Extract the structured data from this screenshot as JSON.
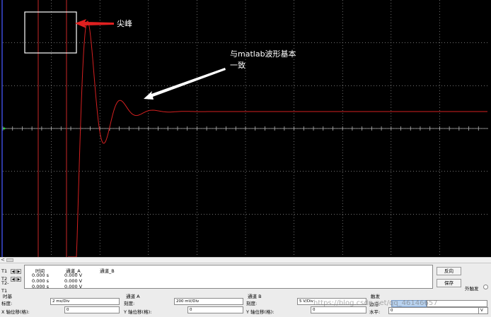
{
  "colors": {
    "screen_bg": "#000000",
    "grid": "#b4b4b4",
    "trace": "#d42020",
    "cursor_line": "#c82828",
    "annotation_red": "#e02020",
    "annotation_white": "#ffffff"
  },
  "annotations": {
    "peak": "尖峰",
    "match_line1": "与matlab波形基本",
    "match_line2": "一致"
  },
  "scroll": {
    "left_arrow": "<"
  },
  "cursors": {
    "headers": {
      "time": "时间",
      "channel_a": "通道_A",
      "channel_b": "通道_B"
    },
    "rows": [
      {
        "label": "T1",
        "time": "0.000 s",
        "channel_a": "0.000 V"
      },
      {
        "label": "T2",
        "time": "0.000 s",
        "channel_a": "0.000 V"
      },
      {
        "label": "T2-T1",
        "time": "0.000 s",
        "channel_a": "0.000 V"
      }
    ],
    "left_arrow": "◀",
    "right_arrow": "▶"
  },
  "buttons": {
    "reverse": "反向",
    "save": "保存"
  },
  "external_trigger": "外触发",
  "timebase": {
    "title": "时基",
    "scale_label": "标度:",
    "scale_value": "2 ms/Div",
    "offset_label": "X 轴位移(格):",
    "offset_value": "0"
  },
  "channel_a": {
    "title": "通道 A",
    "scale_label": "刻度:",
    "scale_value": "200 mV/Div",
    "offset_label": "Y 轴位移(格):",
    "offset_value": "0"
  },
  "channel_b": {
    "title": "通道 B",
    "scale_label": "刻度:",
    "scale_value": "5  V/Div",
    "offset_label": "Y 轴位移(格):",
    "offset_value": "0"
  },
  "trigger": {
    "title": "触发",
    "edge_label": "边沿:",
    "level_label": "水平:",
    "level_value": "0",
    "level_unit": "V"
  },
  "watermark": "https://blog.csdn.net/qq_46146657",
  "icons": {
    "left_arrow": "left-arrow-icon",
    "right_arrow": "right-arrow-icon"
  }
}
